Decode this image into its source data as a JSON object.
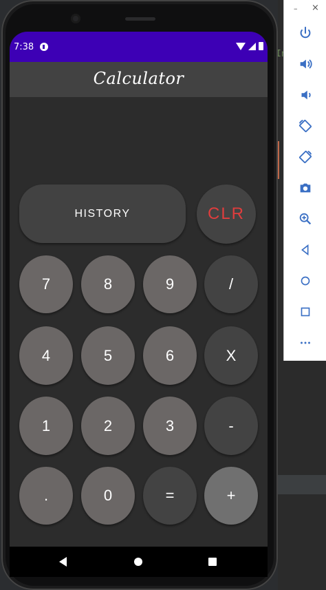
{
  "status_bar": {
    "time": "7:38"
  },
  "app_bar": {
    "title": "Calculator"
  },
  "buttons": {
    "history": "HISTORY",
    "clear": "CLR",
    "seven": "7",
    "eight": "8",
    "nine": "9",
    "divide": "/",
    "four": "4",
    "five": "5",
    "six": "6",
    "multiply": "X",
    "one": "1",
    "two": "2",
    "three": "3",
    "minus": "-",
    "dot": ".",
    "zero": "0",
    "equals": "=",
    "plus": "+"
  },
  "ide": {
    "right_text": "In"
  },
  "emulator_toolbar": {
    "window_controls": {
      "minimize": "–",
      "close": "×"
    },
    "tools": [
      "power-icon",
      "volume-up-icon",
      "volume-down-icon",
      "rotate-left-icon",
      "rotate-right-icon",
      "camera-icon",
      "zoom-icon",
      "back-icon",
      "home-icon",
      "overview-icon",
      "more-icon"
    ]
  },
  "colors": {
    "status_bar": "#3d00b5",
    "app_bar": "#424242",
    "background": "#2c2c2c",
    "number_button": "#6b6766",
    "operator_button": "#434343",
    "clear_text": "#e03d3d",
    "toolbar_icon": "#3a6fc4"
  }
}
